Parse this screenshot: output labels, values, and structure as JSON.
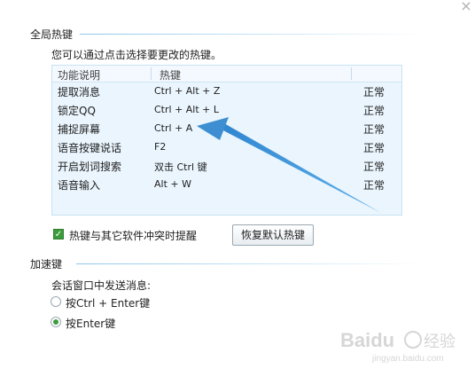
{
  "global_hotkeys": {
    "section_title": "全局热键",
    "description": "您可以通过点击选择要更改的热键。",
    "table": {
      "headers": [
        "功能说明",
        "热键"
      ],
      "rows": [
        {
          "function": "提取消息",
          "hotkey": "Ctrl + Alt + Z",
          "status": "正常"
        },
        {
          "function": "锁定QQ",
          "hotkey": "Ctrl + Alt + L",
          "status": "正常"
        },
        {
          "function": "捕捉屏幕",
          "hotkey": "Ctrl + A",
          "status": "正常"
        },
        {
          "function": "语音按键说话",
          "hotkey": "F2",
          "status": "正常"
        },
        {
          "function": "开启划词搜索",
          "hotkey": "双击 Ctrl 键",
          "status": "正常"
        },
        {
          "function": "语音输入",
          "hotkey": "Alt + W",
          "status": "正常"
        }
      ]
    },
    "conflict_checkbox": {
      "label": "热键与其它软件冲突时提醒",
      "checked": true
    },
    "restore_button": "恢复默认热键"
  },
  "accelerators": {
    "section_title": "加速键",
    "send_label": "会话窗口中发送消息:",
    "options": [
      {
        "label": "按Ctrl + Enter键",
        "selected": false
      },
      {
        "label": "按Enter键",
        "selected": true
      }
    ]
  },
  "watermark": {
    "brand": "Baidu",
    "text": "经验",
    "url": "jingyan.baidu.com"
  },
  "colors": {
    "accent_green": "#3c9c3c",
    "table_bg": "#eaf5fd",
    "arrow_blue": "#3d8fd1"
  }
}
